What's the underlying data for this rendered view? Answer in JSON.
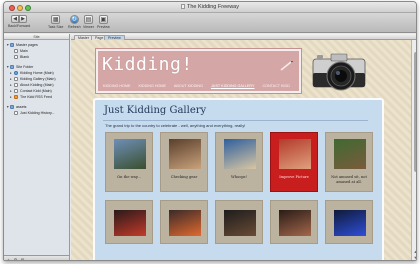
{
  "window": {
    "title": "The Kidding Freeway"
  },
  "toolbar": {
    "back_forward_label": "Back/Forward",
    "buttons": [
      {
        "label": "Task Size",
        "icon": "task-size-icon"
      },
      {
        "label": "Refresh",
        "icon": "refresh-icon"
      },
      {
        "label": "Viewer",
        "icon": "viewer-icon"
      },
      {
        "label": "Preview",
        "icon": "preview-icon"
      }
    ]
  },
  "sidebar": {
    "header": "Site",
    "groups": [
      {
        "label": "Master pages",
        "items": [
          "Main",
          "Blank"
        ]
      },
      {
        "label": "Site Folder",
        "items": [
          "Kidding Home (Main)",
          "Kidding Gallery (Main)",
          "About Kidding (Main)",
          "Contact Kidd (Main)",
          "The Kidd RSS Feed"
        ]
      },
      {
        "label": "assets",
        "items": [
          "Just Kidding History..."
        ]
      }
    ]
  },
  "tabs": [
    "Master",
    "Page",
    "Preview"
  ],
  "site": {
    "title": "Kidding!",
    "nav": [
      "KIDDING HOME",
      "KIDDING HOME",
      "ABOUT KIDDING",
      "JUST KIDDING GALLERY",
      "CONTACT KIDD"
    ],
    "current_nav_index": 3,
    "gallery_title": "Just Kidding Gallery",
    "gallery_desc": "The grand trip to the country to celebrate - well, anything and everything, really!",
    "thumbnails": [
      {
        "caption": "On the way...",
        "colors": [
          "#6e8fb8",
          "#3a4f2e"
        ]
      },
      {
        "caption": "Checking gear",
        "colors": [
          "#5a3f2c",
          "#c9a27c"
        ]
      },
      {
        "caption": "Whoops!",
        "colors": [
          "#2e5f9e",
          "#d7c6a3"
        ]
      },
      {
        "caption": "Improve Picture",
        "colors": [
          "#b23b2c",
          "#e0a07e"
        ]
      },
      {
        "caption": "Not amused sit, not amused at all.",
        "colors": [
          "#3f6a32",
          "#7a5b3c"
        ]
      }
    ],
    "thumbnails_row2": [
      {
        "caption": "",
        "colors": [
          "#2a1a1a",
          "#c43a2a"
        ]
      },
      {
        "caption": "",
        "colors": [
          "#3a2a2a",
          "#e06a2e"
        ]
      },
      {
        "caption": "",
        "colors": [
          "#1d1d1d",
          "#6a4b35"
        ]
      },
      {
        "caption": "",
        "colors": [
          "#2a1c18",
          "#a3674a"
        ]
      },
      {
        "caption": "",
        "colors": [
          "#0f1a3a",
          "#2e4fd8"
        ]
      }
    ]
  },
  "colors": {
    "header_pink": "#d5a6a6",
    "panel_blue": "#c7dbee",
    "highlight_red": "#c91e1e"
  }
}
